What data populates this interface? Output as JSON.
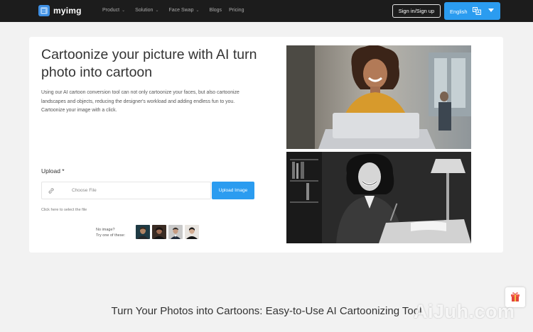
{
  "nav": {
    "brand": "myimg",
    "items": [
      {
        "label": "Product",
        "has_dropdown": true
      },
      {
        "label": "Solution",
        "has_dropdown": true
      },
      {
        "label": "Face Swap",
        "has_dropdown": true
      },
      {
        "label": "Blogs",
        "has_dropdown": false
      },
      {
        "label": "Pricing",
        "has_dropdown": false
      }
    ],
    "signin_label": "Sign in/Sign up",
    "language": "English"
  },
  "hero": {
    "title": "Cartoonize your picture with AI turn photo into cartoon",
    "description": "Using our AI cartoon conversion tool can not only cartoonize your faces, but also cartoonize landscapes and objects, reducing the designer's workload and adding endless fun to you. Cartoonize your image with a click.",
    "upload_label": "Upload *",
    "upload_placeholder": "Choose File",
    "upload_button": "Upload Image",
    "hint": "Click here to select the file",
    "samples_prompt_line1": "No image?",
    "samples_prompt_line2": "Try one of these:"
  },
  "section": {
    "heading": "Turn Your Photos into Cartoons: Easy-to-Use AI Cartoonizing Tool"
  },
  "watermark": "AiJuh.com",
  "colors": {
    "nav_bg": "#1c1c1c",
    "accent": "#2b9cf0",
    "page_bg": "#f2f2f2"
  },
  "icons": [
    "logo-icon",
    "chevron-down-icon",
    "translate-icon",
    "caret-down-icon",
    "link-icon",
    "gift-icon"
  ]
}
